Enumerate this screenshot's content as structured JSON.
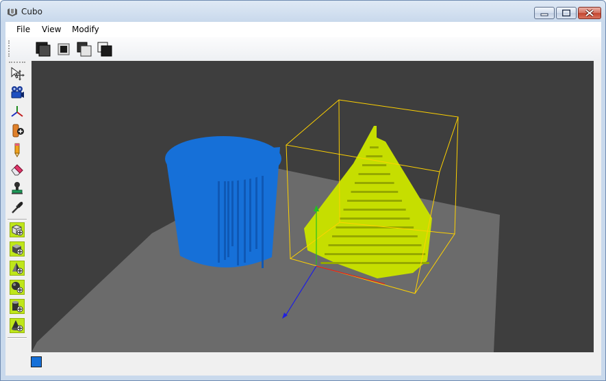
{
  "window": {
    "title": "Cubo"
  },
  "menu": {
    "items": [
      "File",
      "View",
      "Modify"
    ]
  },
  "toolbar": {
    "buttons": [
      {
        "icon": "shape-dark-large-icon"
      },
      {
        "icon": "shape-dark-small-icon"
      },
      {
        "icon": "shape-light-offset-icon"
      },
      {
        "icon": "shape-dark-offset-icon"
      }
    ]
  },
  "tools": [
    {
      "icon": "select-move-icon"
    },
    {
      "icon": "camera-icon"
    },
    {
      "icon": "axes-icon"
    },
    {
      "icon": "add-object-icon"
    },
    {
      "icon": "pencil-icon"
    },
    {
      "icon": "eraser-icon"
    },
    {
      "icon": "stamp-icon"
    },
    {
      "icon": "eyedropper-icon"
    }
  ],
  "shape_tools": [
    {
      "icon": "add-box-wire-icon"
    },
    {
      "icon": "add-cube-icon"
    },
    {
      "icon": "add-pyramid-icon"
    },
    {
      "icon": "add-sphere-icon"
    },
    {
      "icon": "add-cylinder-icon"
    },
    {
      "icon": "add-cone-icon"
    }
  ],
  "status": {
    "current_color": "#1670d8"
  },
  "scene": {
    "background": "#3e3e3e",
    "floor_color": "#6b6b6b",
    "cylinder_color": "#1670d8",
    "cone_color": "#c6de00",
    "selection_box_color": "#ffd200"
  }
}
